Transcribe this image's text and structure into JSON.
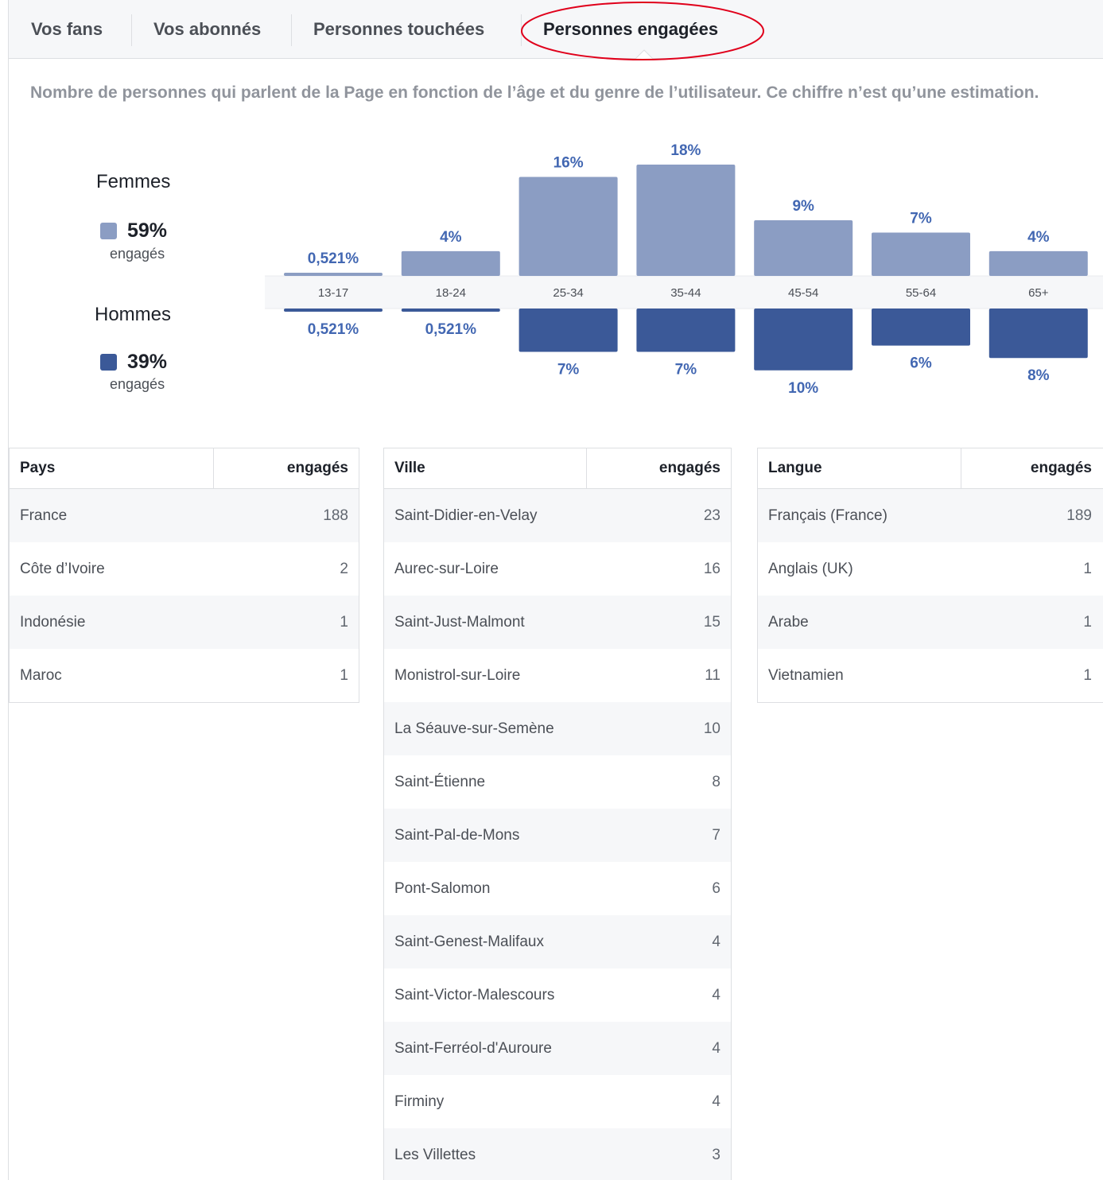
{
  "tabs": [
    {
      "label": "Vos fans"
    },
    {
      "label": "Vos abonnés"
    },
    {
      "label": "Personnes touchées"
    },
    {
      "label": "Personnes engagées"
    }
  ],
  "description": "Nombre de personnes qui parlent de la Page en fonction de l’âge et du genre de l’utilisateur. Ce chiffre n’est qu’une estimation.",
  "legend": {
    "women": {
      "title": "Femmes",
      "pct": "59%",
      "sub": "engagés",
      "color": "#8b9dc3"
    },
    "men": {
      "title": "Hommes",
      "pct": "39%",
      "sub": "engagés",
      "color": "#3b5998"
    }
  },
  "colors": {
    "accent_light": "#8b9dc3",
    "accent_dark": "#3b5998",
    "highlight": "#e0001b",
    "label_text": "#4267b2"
  },
  "chart_data": {
    "type": "bar",
    "categories": [
      "13-17",
      "18-24",
      "25-34",
      "35-44",
      "45-54",
      "55-64",
      "65+"
    ],
    "series": [
      {
        "name": "Femmes",
        "values": [
          0.521,
          4,
          16,
          18,
          9,
          7,
          4
        ],
        "labels": [
          "0,521%",
          "4%",
          "16%",
          "18%",
          "9%",
          "7%",
          "4%"
        ]
      },
      {
        "name": "Hommes",
        "values": [
          0.521,
          0.521,
          7,
          7,
          10,
          6,
          8
        ],
        "labels": [
          "0,521%",
          "0,521%",
          "7%",
          "7%",
          "10%",
          "6%",
          "8%"
        ]
      }
    ],
    "ylim": [
      0,
      18
    ]
  },
  "tables": {
    "country": {
      "header_left": "Pays",
      "header_right": "engagés",
      "rows": [
        {
          "name": "France",
          "value": "188"
        },
        {
          "name": "Côte d’Ivoire",
          "value": "2"
        },
        {
          "name": "Indonésie",
          "value": "1"
        },
        {
          "name": "Maroc",
          "value": "1"
        }
      ]
    },
    "city": {
      "header_left": "Ville",
      "header_right": "engagés",
      "rows": [
        {
          "name": "Saint-Didier-en-Velay",
          "value": "23"
        },
        {
          "name": "Aurec-sur-Loire",
          "value": "16"
        },
        {
          "name": "Saint-Just-Malmont",
          "value": "15"
        },
        {
          "name": "Monistrol-sur-Loire",
          "value": "11"
        },
        {
          "name": "La Séauve-sur-Semène",
          "value": "10"
        },
        {
          "name": "Saint-Étienne",
          "value": "8"
        },
        {
          "name": "Saint-Pal-de-Mons",
          "value": "7"
        },
        {
          "name": "Pont-Salomon",
          "value": "6"
        },
        {
          "name": "Saint-Genest-Malifaux",
          "value": "4"
        },
        {
          "name": "Saint-Victor-Malescours",
          "value": "4"
        },
        {
          "name": "Saint-Ferréol-d'Auroure",
          "value": "4"
        },
        {
          "name": "Firminy",
          "value": "4"
        },
        {
          "name": "Les Villettes",
          "value": "3"
        }
      ]
    },
    "language": {
      "header_left": "Langue",
      "header_right": "engagés",
      "rows": [
        {
          "name": "Français (France)",
          "value": "189"
        },
        {
          "name": "Anglais (UK)",
          "value": "1"
        },
        {
          "name": "Arabe",
          "value": "1"
        },
        {
          "name": "Vietnamien",
          "value": "1"
        }
      ]
    }
  }
}
